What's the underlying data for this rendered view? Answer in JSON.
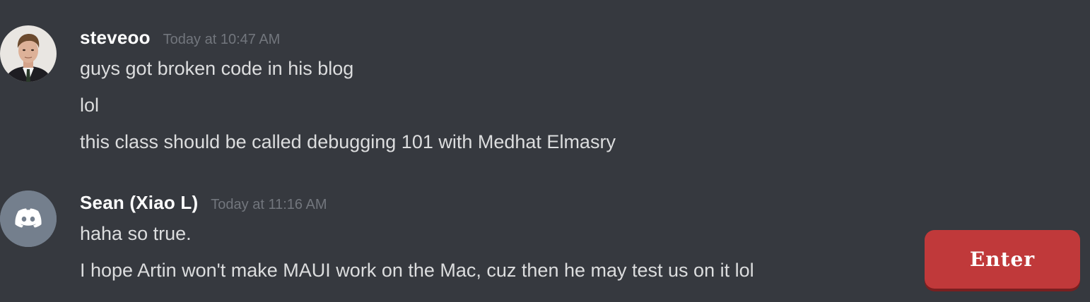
{
  "messages": [
    {
      "username": "steveoo",
      "timestamp": "Today at 10:47 AM",
      "avatar": "photo-avatar",
      "lines": [
        "guys got broken code in his blog",
        "lol",
        "this class should be called debugging 101 with Medhat Elmasry"
      ]
    },
    {
      "username": "Sean (Xiao L)",
      "timestamp": "Today at 11:16 AM",
      "avatar": "discord-logo-icon",
      "lines": [
        "haha so true.",
        "I hope Artin won't make MAUI work on the Mac, cuz then he may test us on it lol"
      ]
    }
  ],
  "enter_button": {
    "label": "Enter"
  },
  "colors": {
    "background": "#36393f",
    "username": "#ffffff",
    "message_text": "#dcddde",
    "timestamp": "#72767d",
    "discord_avatar_bg": "#747f8d",
    "enter_button": "#c0393a"
  }
}
